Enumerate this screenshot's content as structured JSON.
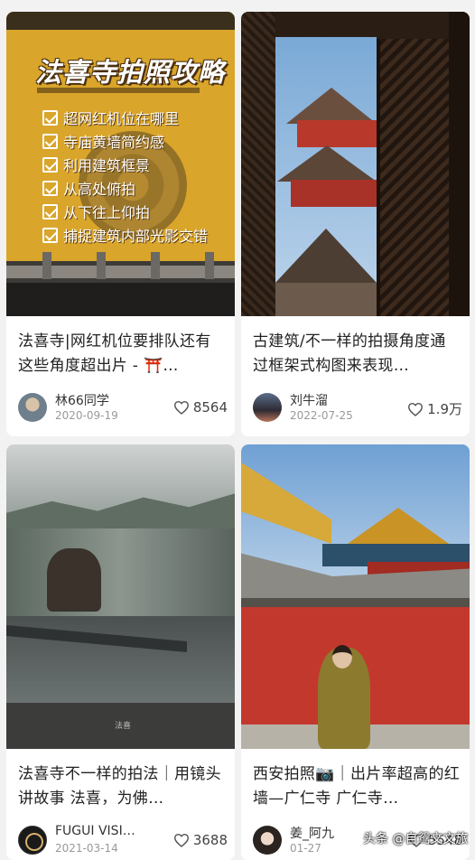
{
  "feed": {
    "cards": [
      {
        "thumb_title": "法喜寺拍照攻略",
        "thumb_list": [
          "超网红机位在哪里",
          "寺庙黄墙简约感",
          "利用建筑框景",
          "从高处俯拍",
          "从下往上仰拍",
          "捕捉建筑内部光影交错"
        ],
        "title": "法喜寺|网红机位要排队还有这些角度超出片 - ⛩️…",
        "author": "林66同学",
        "date": "2020-09-19",
        "likes": "8564"
      },
      {
        "title": "古建筑/不一样的拍摄角度通过框架式构图来表现…",
        "author": "刘牛溜",
        "date": "2022-07-25",
        "likes": "1.9万"
      },
      {
        "thumb_caption": "法喜",
        "title": "法喜寺不一样的拍法｜用镜头讲故事 法喜，为佛…",
        "author": "FUGUI VISI…",
        "date": "2021-03-14",
        "likes": "3688"
      },
      {
        "title": "西安拍照📷｜出片率超高的红墙—广仁寺 广仁寺…",
        "author": "姜_阿九",
        "date": "01-27",
        "likes": "5548"
      }
    ]
  },
  "watermark": "头条 @自鸳文文旅"
}
